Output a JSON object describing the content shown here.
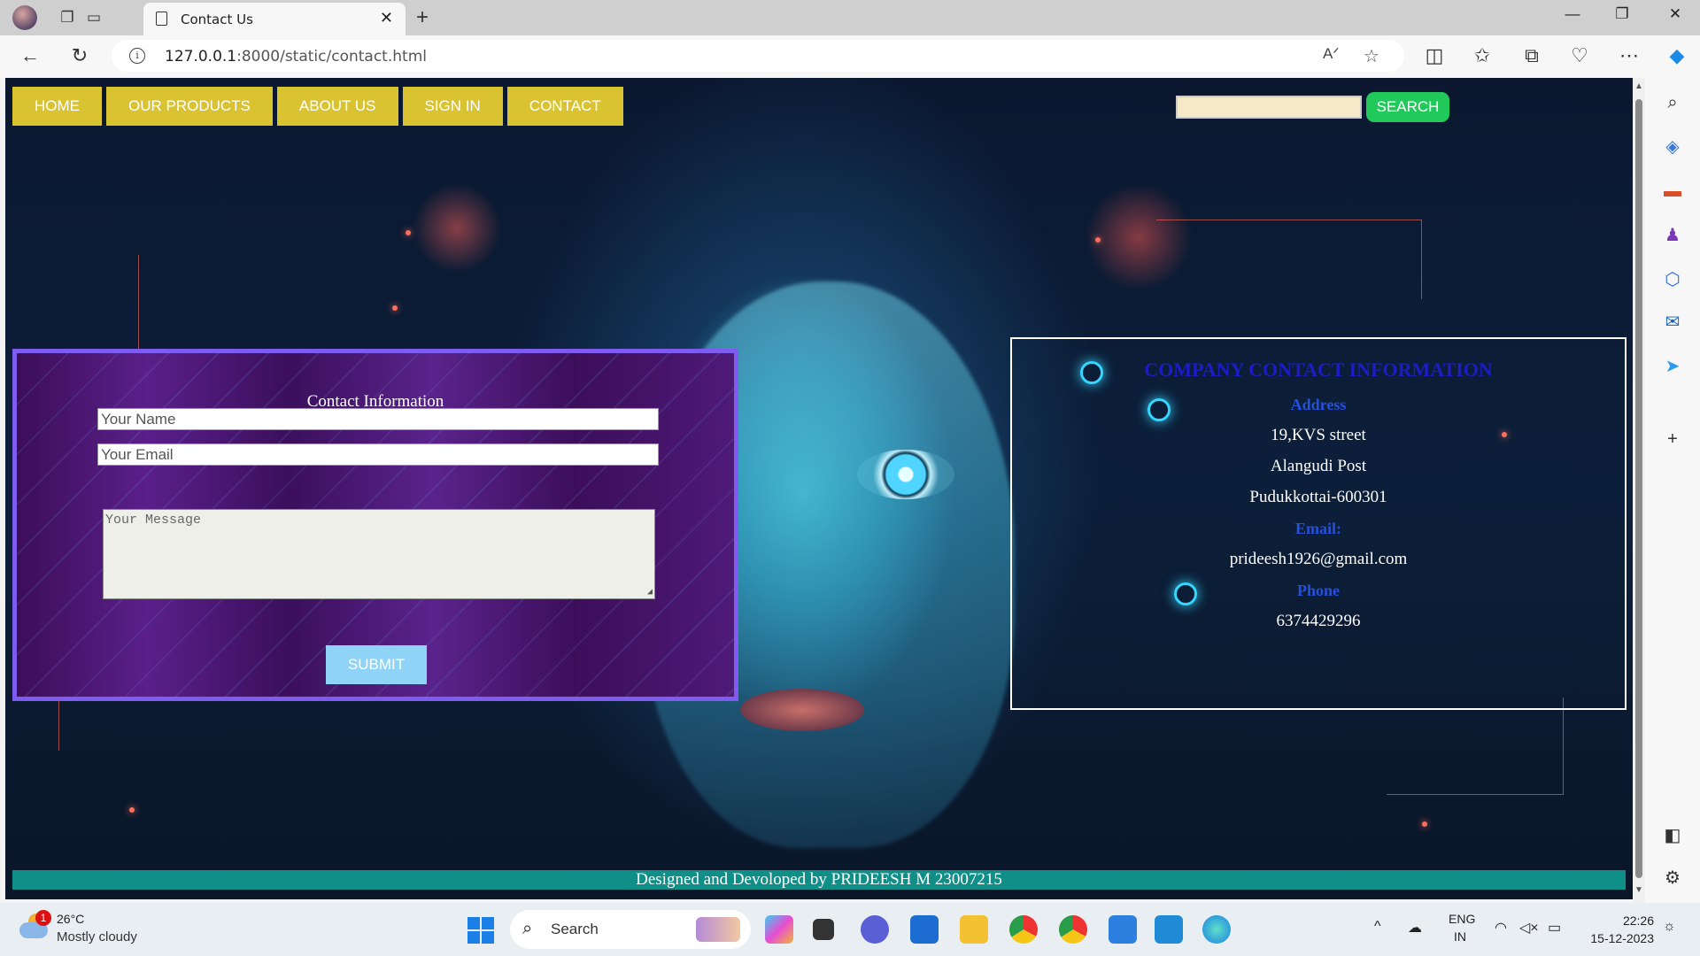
{
  "browser": {
    "tab_title": "Contact Us",
    "url_host": "127.0.0.1",
    "url_path": ":8000/static/contact.html"
  },
  "nav": {
    "items": [
      "HOME",
      "OUR PRODUCTS",
      "ABOUT US",
      "SIGN IN",
      "CONTACT"
    ],
    "search_value": "",
    "search_button": "SEARCH"
  },
  "form": {
    "title": "Contact Information",
    "name_placeholder": "Your Name",
    "email_placeholder": "Your Email",
    "message_placeholder": "Your Message",
    "submit_label": "SUBMIT"
  },
  "company": {
    "heading": "COMPANY CONTACT INFORMATION",
    "address_label": "Address",
    "address_lines": [
      "19,KVS street",
      "Alangudi Post",
      "Pudukkottai-600301"
    ],
    "email_label": "Email:",
    "email": "prideesh1926@gmail.com",
    "phone_label": "Phone",
    "phone": "6374429296"
  },
  "footer": {
    "credit": "Designed and Devoloped by PRIDEESH M 23007215"
  },
  "taskbar": {
    "weather_badge": "1",
    "temperature": "26°C",
    "weather": "Mostly cloudy",
    "search_label": "Search",
    "lang_top": "ENG",
    "lang_bottom": "IN",
    "time": "22:26",
    "date": "15-12-2023"
  },
  "colors": {
    "nav_button": "#d9c331",
    "search_button": "#21c95a",
    "form_border": "#7f5cf0",
    "submit_button": "#8fd3f6",
    "footer_bar": "#0f8f87",
    "company_heading": "#1c1cc8"
  }
}
